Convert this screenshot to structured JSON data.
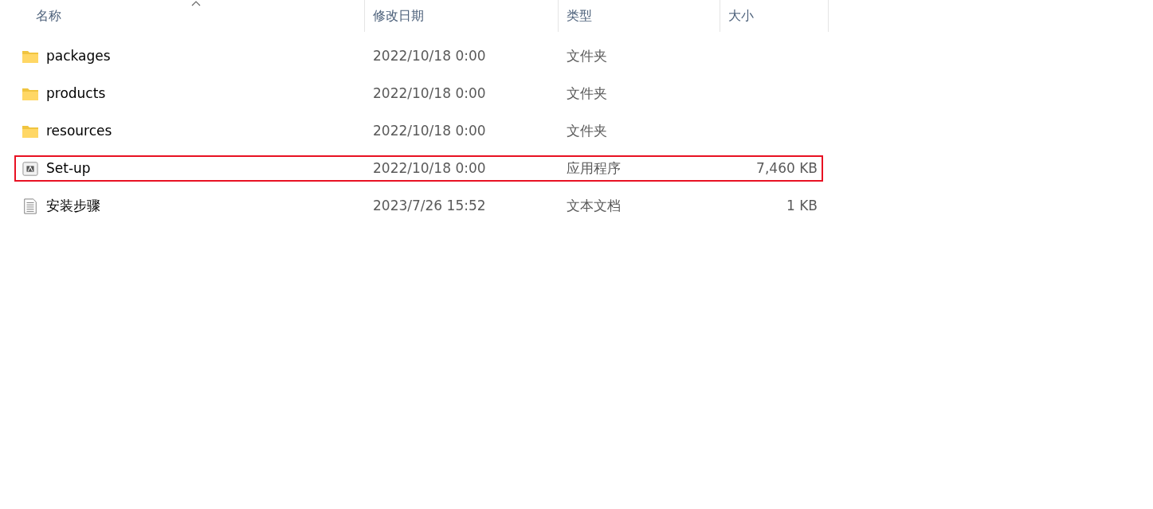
{
  "columns": [
    {
      "label": "名称",
      "sorted": true
    },
    {
      "label": "修改日期",
      "sorted": false
    },
    {
      "label": "类型",
      "sorted": false
    },
    {
      "label": "大小",
      "sorted": false
    }
  ],
  "rows": [
    {
      "kind": "folder",
      "name": "packages",
      "date": "2022/10/18 0:00",
      "type": "文件夹",
      "highlighted": false
    },
    {
      "kind": "folder",
      "name": "products",
      "date": "2022/10/18 0:00",
      "type": "文件夹",
      "highlighted": false
    },
    {
      "kind": "folder",
      "name": "resources",
      "date": "2022/10/18 0:00",
      "type": "文件夹",
      "highlighted": false
    },
    {
      "kind": "app",
      "name": "Set-up",
      "date": "2022/10/18 0:00",
      "type": "应用程序",
      "size": "7,460 KB",
      "highlighted": true
    },
    {
      "kind": "text",
      "name": "安装步骤",
      "date": "2023/7/26 15:52",
      "type": "文本文档",
      "size": "1 KB",
      "highlighted": false
    }
  ]
}
